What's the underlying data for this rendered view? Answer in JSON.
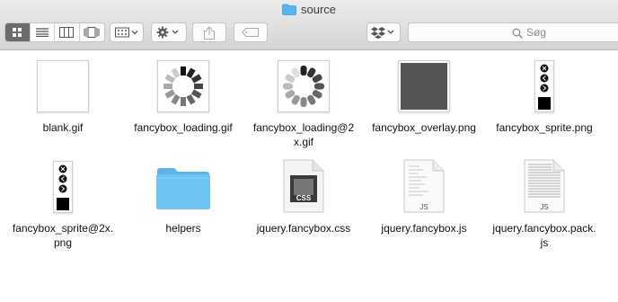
{
  "window": {
    "title": "source"
  },
  "toolbar": {
    "search_placeholder": "Søg"
  },
  "files": [
    {
      "name": "blank.gif"
    },
    {
      "name": "fancybox_loading.gif"
    },
    {
      "name": "fancybox_loading@2x.gif"
    },
    {
      "name": "fancybox_overlay.png"
    },
    {
      "name": "fancybox_sprite.png"
    },
    {
      "name": "fancybox_sprite@2x.png"
    },
    {
      "name": "helpers"
    },
    {
      "name": "jquery.fancybox.css",
      "badge": "CSS"
    },
    {
      "name": "jquery.fancybox.js",
      "badge": "JS"
    },
    {
      "name": "jquery.fancybox.pack.js",
      "badge": "JS"
    }
  ],
  "colors": {
    "folder": "#5ab4ec",
    "overlay": "#555555",
    "accent": "#6c6c6c"
  }
}
